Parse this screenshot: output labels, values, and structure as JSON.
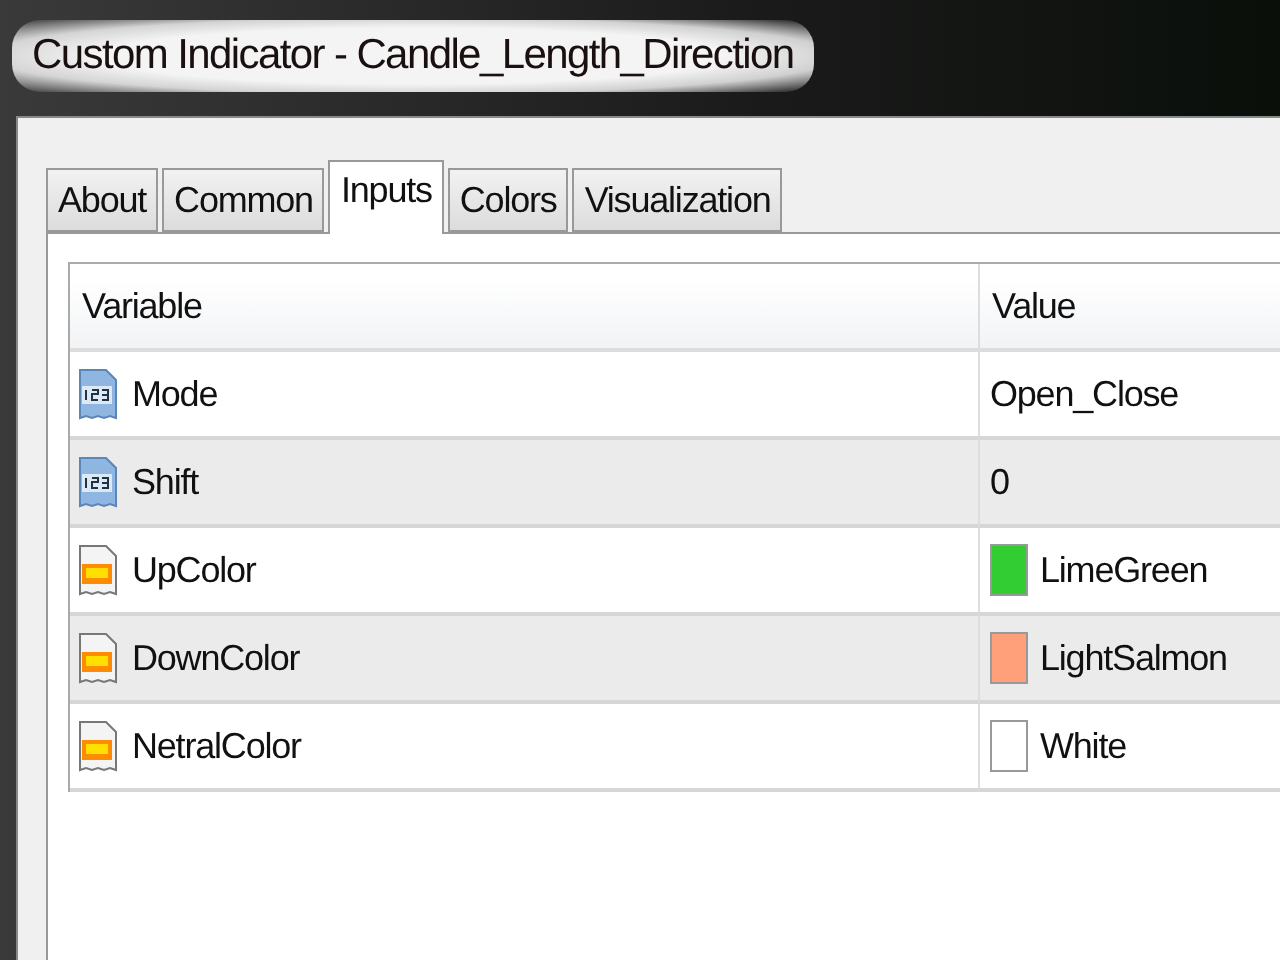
{
  "window": {
    "title": "Custom Indicator - Candle_Length_Direction"
  },
  "tabs": [
    {
      "label": "About",
      "selected": false
    },
    {
      "label": "Common",
      "selected": false
    },
    {
      "label": "Inputs",
      "selected": true
    },
    {
      "label": "Colors",
      "selected": false
    },
    {
      "label": "Visualization",
      "selected": false
    }
  ],
  "table": {
    "columns": [
      "Variable",
      "Value"
    ],
    "rows": [
      {
        "kind": "number",
        "variable": "Mode",
        "value": "Open_Close"
      },
      {
        "kind": "number",
        "variable": "Shift",
        "value": "0"
      },
      {
        "kind": "color",
        "variable": "UpColor",
        "value": "LimeGreen",
        "color": "#32cd32"
      },
      {
        "kind": "color",
        "variable": "DownColor",
        "value": "LightSalmon",
        "color": "#ffa07a"
      },
      {
        "kind": "color",
        "variable": "NetralColor",
        "value": "White",
        "color": "#ffffff"
      }
    ]
  }
}
